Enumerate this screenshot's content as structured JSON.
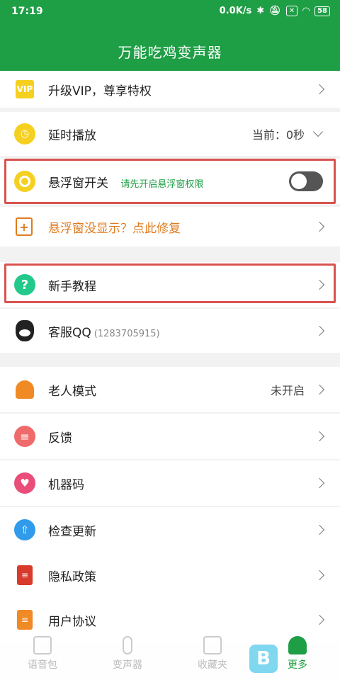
{
  "status": {
    "time": "17:19",
    "speed": "0.0K/s",
    "battery": "58"
  },
  "header": {
    "title": "万能吃鸡变声器"
  },
  "rows": {
    "vip": {
      "label": "升级VIP，尊享特权"
    },
    "delay": {
      "label": "延时播放",
      "value": "当前：0秒"
    },
    "float": {
      "label": "悬浮窗开关",
      "hint": "请先开启悬浮窗权限"
    },
    "fix": {
      "label": "悬浮窗没显示？点此修复"
    },
    "tutorial": {
      "label": "新手教程"
    },
    "qq": {
      "label": "客服QQ",
      "sub": "(1283705915)"
    },
    "elder": {
      "label": "老人模式",
      "value": "未开启"
    },
    "feedback": {
      "label": "反馈"
    },
    "machine": {
      "label": "机器码"
    },
    "update": {
      "label": "检查更新"
    },
    "privacy": {
      "label": "隐私政策"
    },
    "agreement": {
      "label": "用户协议"
    }
  },
  "tabs": {
    "voice_pack": "语音包",
    "voice_changer": "变声器",
    "favorites": "收藏夹",
    "more": "更多"
  },
  "colors": {
    "brand": "#1e9e45",
    "highlight": "#d9534f",
    "orange_text": "#e07b1f"
  }
}
